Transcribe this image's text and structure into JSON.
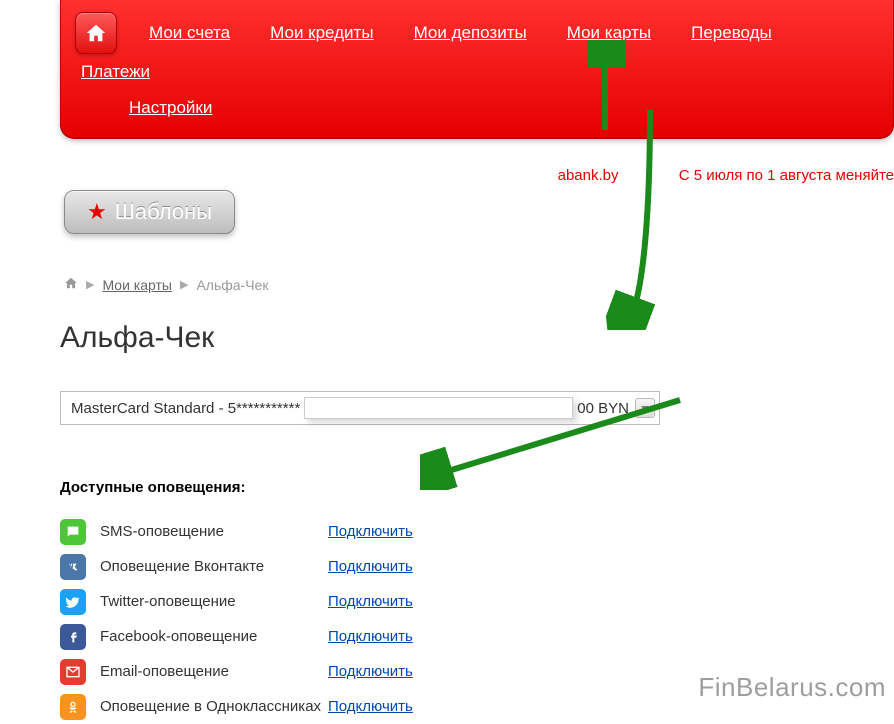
{
  "nav": {
    "items": [
      "Мои счета",
      "Мои кредиты",
      "Мои депозиты",
      "Мои карты",
      "Переводы",
      "Платежи"
    ],
    "row2": "Настройки"
  },
  "ticker": {
    "t1": "abank.by",
    "t2": "С 5 июля по 1 августа меняйте"
  },
  "templates_btn": "Шаблоны",
  "breadcrumbs": {
    "link": "Мои карты",
    "current": "Альфа-Чек"
  },
  "page_title": "Альфа-Чек",
  "card_select": {
    "prefix": "MasterCard Standard - 5***********",
    "suffix": "00 BYN"
  },
  "section_title": "Доступные оповещения:",
  "notifications": [
    {
      "icon": "sms",
      "label": "SMS-оповещение",
      "action": "Подключить"
    },
    {
      "icon": "vk",
      "label": "Оповещение Вконтакте",
      "action": "Подключить"
    },
    {
      "icon": "tw",
      "label": "Twitter-оповещение",
      "action": "Подключить"
    },
    {
      "icon": "fb",
      "label": "Facebook-оповещение",
      "action": "Подключить"
    },
    {
      "icon": "mail",
      "label": "Email-оповещение",
      "action": "Подключить"
    },
    {
      "icon": "ok",
      "label": "Оповещение в Одноклассниках",
      "action": "Подключить"
    }
  ],
  "watermark": "FinBelarus.com"
}
